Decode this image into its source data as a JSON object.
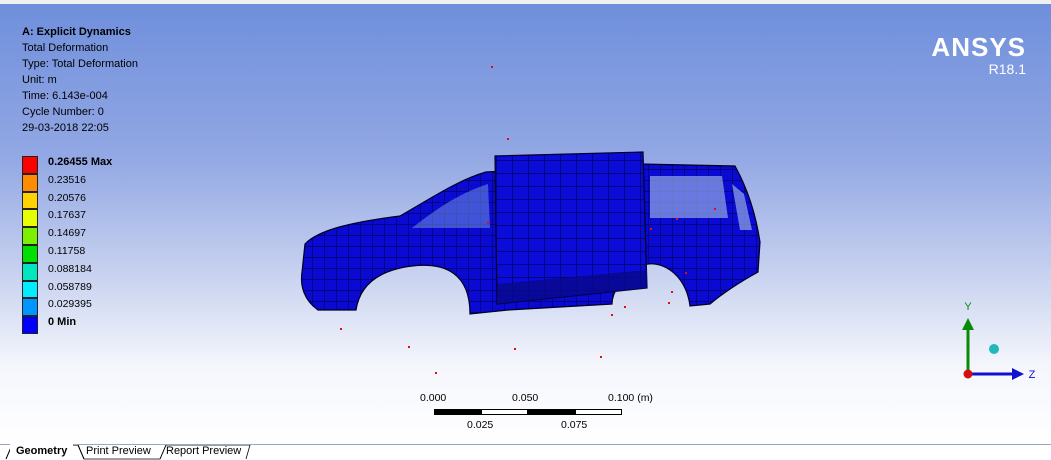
{
  "info": {
    "title": "A: Explicit Dynamics",
    "result": "Total Deformation",
    "type": "Type: Total Deformation",
    "unit": "Unit: m",
    "time": "Time: 6.143e-004",
    "cycle": "Cycle Number: 0",
    "date": "29-03-2018 22:05"
  },
  "logo": {
    "brand": "ANSYS",
    "version": "R18.1"
  },
  "legend": {
    "entries": [
      {
        "label": "0.26455 Max",
        "color": "#ff0000",
        "bold": true
      },
      {
        "label": "0.23516",
        "color": "#ff8c00",
        "bold": false
      },
      {
        "label": "0.20576",
        "color": "#ffd200",
        "bold": false
      },
      {
        "label": "0.17637",
        "color": "#e6ff00",
        "bold": false
      },
      {
        "label": "0.14697",
        "color": "#7cf000",
        "bold": false
      },
      {
        "label": "0.11758",
        "color": "#00e000",
        "bold": false
      },
      {
        "label": "0.088184",
        "color": "#00e6c0",
        "bold": false
      },
      {
        "label": "0.058789",
        "color": "#00ecff",
        "bold": false
      },
      {
        "label": "0.029395",
        "color": "#0096ff",
        "bold": false
      },
      {
        "label": "0 Min",
        "color": "#0000ff",
        "bold": true
      }
    ]
  },
  "scale": {
    "t0": "0.000",
    "t1": "0.050",
    "t2": "0.100 (m)",
    "b1": "0.025",
    "b2": "0.075"
  },
  "axes": {
    "y": "Y",
    "z": "Z"
  },
  "tabs": {
    "geometry": "Geometry",
    "print": "Print Preview",
    "report": "Report Preview"
  },
  "colors": {
    "mesh_fill": "#0a0ad2",
    "mesh_line": "#000033",
    "marker": "#e01010"
  }
}
